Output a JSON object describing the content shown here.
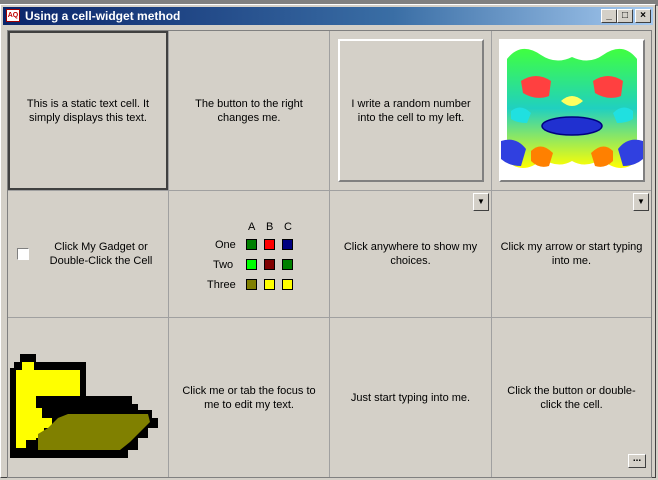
{
  "window": {
    "title": "Using a cell-widget method",
    "app_icon_text": "AQ",
    "controls": {
      "minimize": "_",
      "maximize": "□",
      "close": "×"
    }
  },
  "cells": {
    "r1c1": "This is a static text cell.  It simply displays this text.",
    "r1c2": "The button to the right changes me.",
    "r1c3": "I write a random number into the cell to my left.",
    "r2c1": "Click My Gadget or Double-Click the Cell",
    "r2c3": "Click anywhere to show my choices.",
    "r2c4": "Click my arrow or start typing into me.",
    "r3c2": "Click me or tab the focus to me to edit my text.",
    "r3c3": "Just start typing into me.",
    "r3c4": "Click the button or double-click the cell."
  },
  "matrix": {
    "columns": [
      "A",
      "B",
      "C"
    ],
    "rows": [
      {
        "label": "One",
        "colors": [
          "#008000",
          "#ff0000",
          "#000080"
        ]
      },
      {
        "label": "Two",
        "colors": [
          "#00ff00",
          "#800000",
          "#008000"
        ]
      },
      {
        "label": "Three",
        "colors": [
          "#808000",
          "#ffff00",
          "#ffff00"
        ]
      }
    ]
  },
  "icons": {
    "dropdown_arrow": "▼",
    "ellipsis": "..."
  },
  "colors": {
    "face": "#d4d0c8",
    "title_start": "#0a246a",
    "title_end": "#a6caf0"
  }
}
